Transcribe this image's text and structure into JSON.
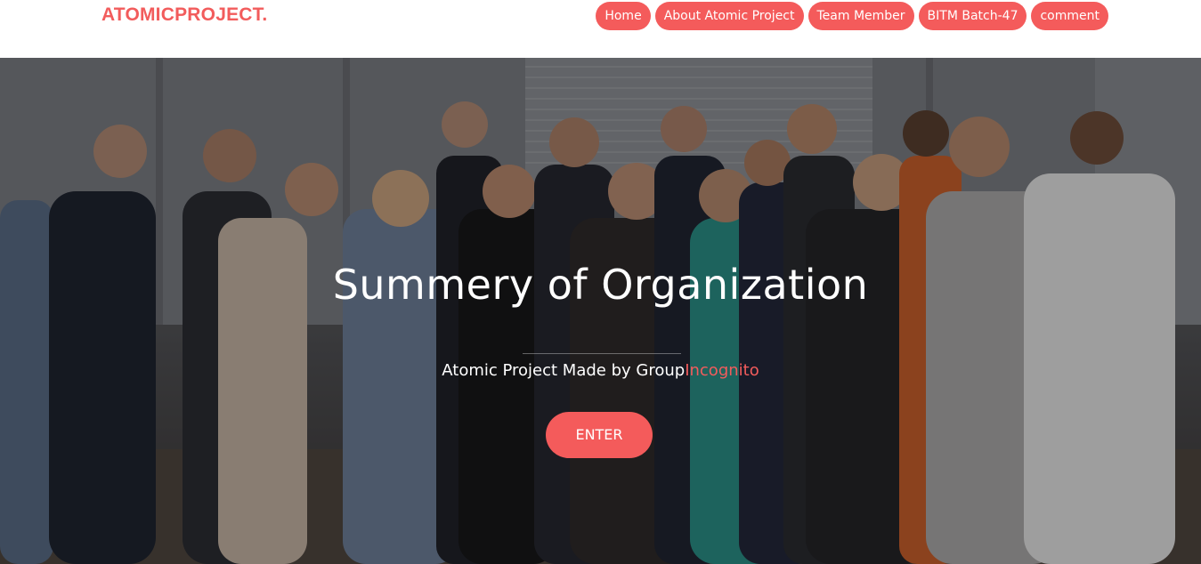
{
  "header": {
    "brand": "ATOMICPROJECT.",
    "nav": [
      {
        "label": "Home"
      },
      {
        "label": "About Atomic Project"
      },
      {
        "label": "Team Member"
      },
      {
        "label": "BITM Batch-47"
      },
      {
        "label": "comment"
      }
    ]
  },
  "hero": {
    "background_image": "group-team-photo",
    "title": "Summery of Organization",
    "subtitle_prefix": "Atomic Project Made by Group",
    "subtitle_accent": "Incognito",
    "enter_label": "ENTER"
  },
  "colors": {
    "accent": "#f45b5b",
    "brand": "#f25c5c",
    "header_bg": "#ffffff"
  }
}
